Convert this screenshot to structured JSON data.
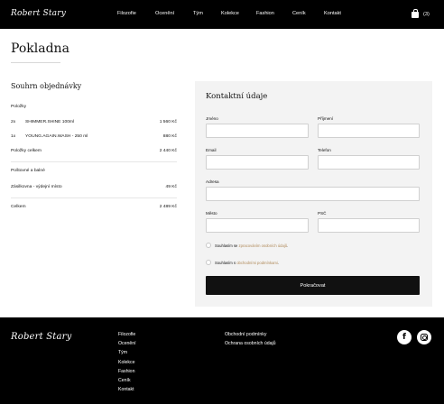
{
  "brand": {
    "logo_text": "Robert Stary"
  },
  "header": {
    "nav": [
      "Filozofie",
      "Ocenění",
      "Tým",
      "Kolekce",
      "Fashion",
      "Ceník",
      "Kontakt"
    ],
    "cart_count": "(3)",
    "cart_icon": "shopping-bag-icon"
  },
  "page": {
    "title": "Pokladna"
  },
  "summary": {
    "heading": "Souhrn objednávky",
    "items_label": "Položky",
    "items": [
      {
        "qty": "2x",
        "name": "SHIMMER.SHINE 100ml",
        "price": "1 560 Kč"
      },
      {
        "qty": "1x",
        "name": "YOUNG.AGAIN.WASH - 250 ml",
        "price": "880 Kč"
      }
    ],
    "items_total_label": "Položky celkem",
    "items_total": "2 440 Kč",
    "shipping_label": "Poštovné a balné",
    "shipping_name": "Zásilkovna - výdejní místo",
    "shipping_price": "49 Kč",
    "total_label": "Celkem",
    "total": "2 489 Kč"
  },
  "contact": {
    "heading": "Kontaktní údaje",
    "first_name_label": "Jméno",
    "last_name_label": "Příjmení",
    "email_label": "Email",
    "phone_label": "Telefon",
    "address_label": "Adresa",
    "city_label": "Město",
    "zip_label": "PSČ",
    "consent1_text": "Souhlasím se ",
    "consent1_link": "zpracováním osobních údajů",
    "consent1_end": ".",
    "consent2_text": "Souhlasím s ",
    "consent2_link": "obchodními podmínkami",
    "consent2_end": ".",
    "submit_label": "Pokračovat"
  },
  "footer": {
    "nav": [
      "Filozofie",
      "Ocenění",
      "Tým",
      "Kolekce",
      "Fashion",
      "Ceník",
      "Kontakt"
    ],
    "links": [
      "Obchodní podmínky",
      "Ochrana osobních údajů"
    ],
    "social": [
      "facebook-icon",
      "instagram-icon"
    ]
  },
  "colors": {
    "accent_link": "#b08a5a",
    "dark": "#000000",
    "panel": "#f3f3f3"
  }
}
